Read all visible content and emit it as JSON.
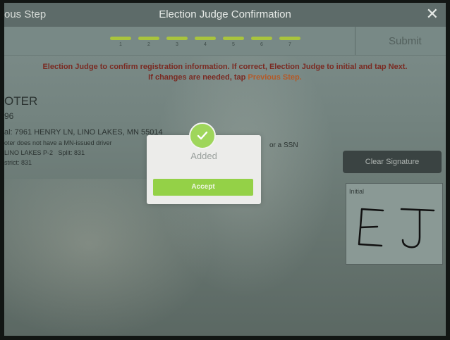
{
  "topbar": {
    "prev_label": "ous Step",
    "title": "Election Judge Confirmation",
    "close_label": "✕"
  },
  "progress": {
    "steps": [
      "1",
      "2",
      "3",
      "4",
      "5",
      "6",
      "7"
    ],
    "submit_label": "Submit",
    "accent": "#a9c43d"
  },
  "instructions": {
    "line1": "Election Judge to confirm registration information.  If correct, Election Judge to initial and tap Next.",
    "line2_prefix": "If changes are needed, tap ",
    "line2_link": "Previous Step."
  },
  "voter": {
    "heading": "OTER",
    "id": "96",
    "address": "al: 7961 HENRY LN, LINO LAKES, MN 55014",
    "license_note": "oter does not have a MN-issued driver",
    "ssn_note": "or a SSN",
    "precinct": "LINO LAKES P-2",
    "split": "Split: 831",
    "district": "strict: 831"
  },
  "signature": {
    "clear_label": "Clear Signature",
    "initial_label": "Initial",
    "ink_color": "#111111"
  },
  "modal": {
    "message": "Added",
    "accept_label": "Accept",
    "accent": "#94d147"
  }
}
